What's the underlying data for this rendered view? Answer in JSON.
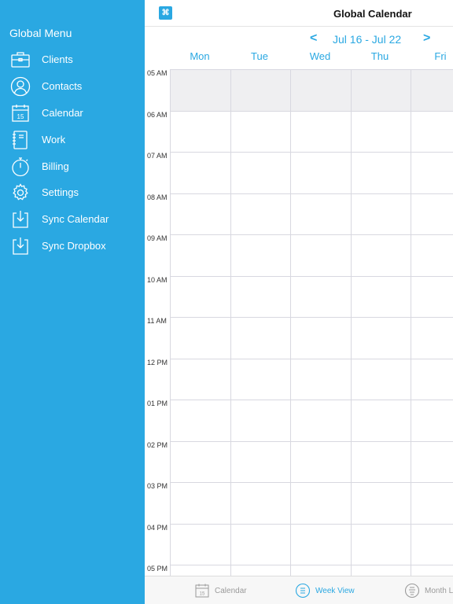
{
  "sidebar": {
    "title": "Global Menu",
    "items": [
      {
        "label": "Clients",
        "icon": "briefcase-icon"
      },
      {
        "label": "Contacts",
        "icon": "person-icon"
      },
      {
        "label": "Calendar",
        "icon": "calendar-icon",
        "day": "15"
      },
      {
        "label": "Work",
        "icon": "notebook-icon"
      },
      {
        "label": "Billing",
        "icon": "stopwatch-icon"
      },
      {
        "label": "Settings",
        "icon": "gear-icon"
      },
      {
        "label": "Sync Calendar",
        "icon": "sync-download-icon"
      },
      {
        "label": "Sync Dropbox",
        "icon": "sync-download-icon"
      }
    ]
  },
  "header": {
    "title": "Global Calendar",
    "menu_icon": "command-icon",
    "menu_glyph": "⌘"
  },
  "week_nav": {
    "prev": "<",
    "range": "Jul 16 - Jul 22",
    "next": ">"
  },
  "days": [
    "Mon",
    "Tue",
    "Wed",
    "Thu",
    "Fri"
  ],
  "times": [
    "05 AM",
    "06 AM",
    "07 AM",
    "08 AM",
    "09 AM",
    "10 AM",
    "11 AM",
    "12 PM",
    "01 PM",
    "02 PM",
    "03 PM",
    "04 PM",
    "05 PM"
  ],
  "tabbar": {
    "tabs": [
      {
        "label": "Calendar",
        "icon": "calendar-icon",
        "day": "15",
        "active": false
      },
      {
        "label": "Week View",
        "icon": "week-view-icon",
        "active": true
      },
      {
        "label": "Month List",
        "icon": "month-list-icon",
        "active": false
      }
    ]
  },
  "colors": {
    "accent": "#2aa8e2",
    "sidebar_bg": "#2aa8e2",
    "inactive_tab": "#9a9a9a",
    "shaded_hour": "#efeff1"
  }
}
